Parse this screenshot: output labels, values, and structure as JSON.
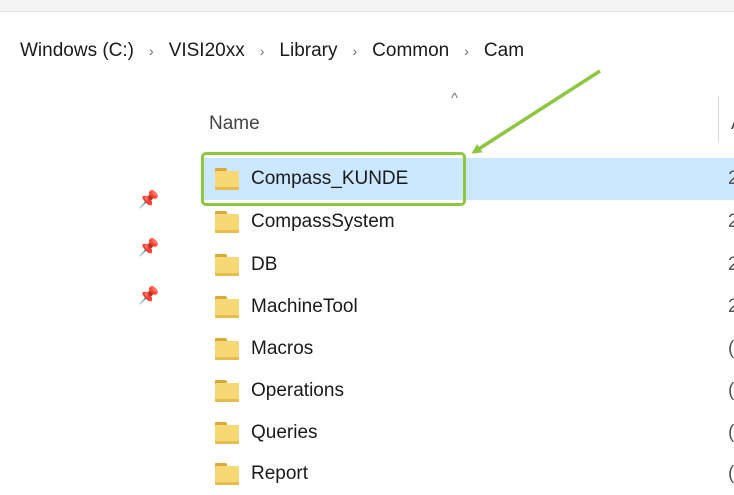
{
  "breadcrumb": {
    "items": [
      "Windows (C:)",
      "VISI20xx",
      "Library",
      "Common",
      "Cam"
    ],
    "separator": "›"
  },
  "columns": {
    "sort_arrow": "^",
    "name": "Name",
    "next_partial": "A"
  },
  "quick_access": {
    "pin_icon": "📌"
  },
  "files": [
    {
      "name": "Compass_KUNDE",
      "trail": "2",
      "selected": true
    },
    {
      "name": "CompassSystem",
      "trail": "2"
    },
    {
      "name": "DB",
      "trail": "2"
    },
    {
      "name": "MachineTool",
      "trail": "2"
    },
    {
      "name": "Macros",
      "trail": "("
    },
    {
      "name": "Operations",
      "trail": "("
    },
    {
      "name": "Queries",
      "trail": "("
    },
    {
      "name": "Report",
      "trail": "("
    }
  ],
  "annotation": {
    "color": "#8dc63f"
  },
  "colors": {
    "selection": "#cce8ff",
    "folder": "#f8d775"
  }
}
